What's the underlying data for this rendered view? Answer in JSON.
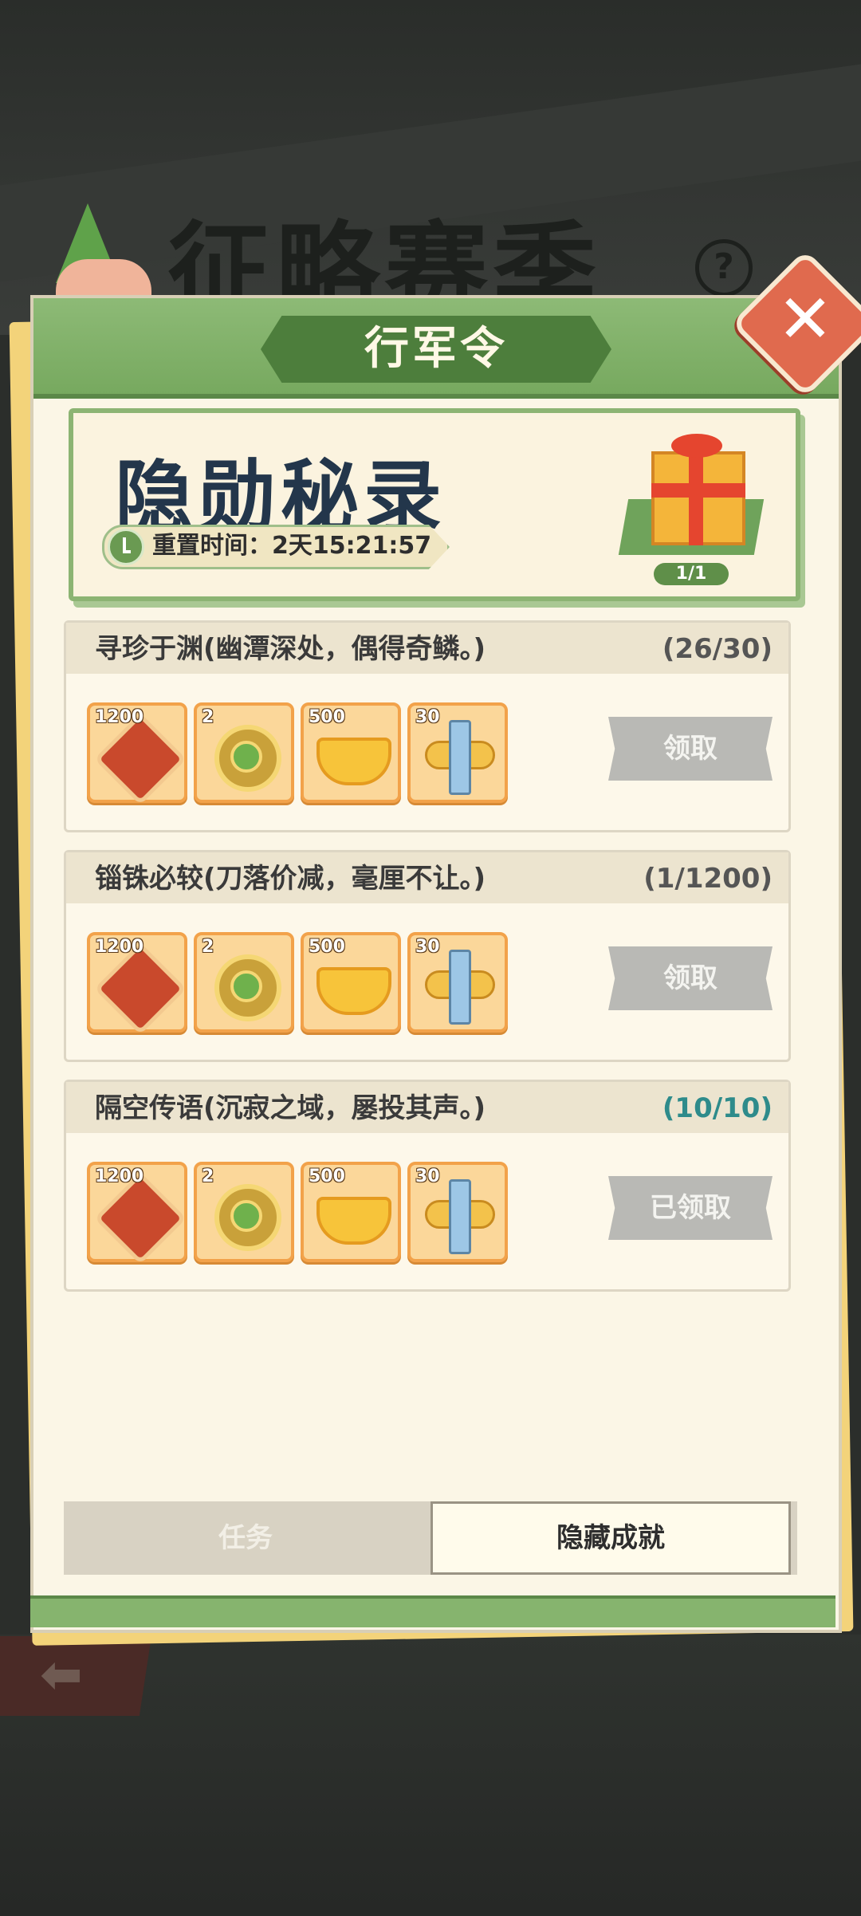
{
  "background": {
    "season_title": "征略赛季",
    "help_icon": "?"
  },
  "header": {
    "title": "行军令",
    "close_label": "✕"
  },
  "banner": {
    "title": "隐勋秘录",
    "timer_label": "重置时间：2天15:21:57",
    "gift_count": "1/1"
  },
  "tasks": [
    {
      "title": "寻珍于渊(幽潭深处，偶得奇鳞。)",
      "progress": "(26/30)",
      "rewards": [
        "1200",
        "2",
        "500",
        "30"
      ],
      "button": "领取"
    },
    {
      "title": "锱铢必较(刀落价减，毫厘不让。)",
      "progress": "(1/1200)",
      "rewards": [
        "1200",
        "2",
        "500",
        "30"
      ],
      "button": "领取"
    },
    {
      "title": "隔空传语(沉寂之域，屡投其声。)",
      "progress": "(10/10)",
      "rewards": [
        "1200",
        "2",
        "500",
        "30"
      ],
      "button": "已领取"
    }
  ],
  "tabs": {
    "task": "任务",
    "hidden": "隐藏成就"
  },
  "icons": {
    "reward_1": "token-icon",
    "reward_2": "coin-icon",
    "reward_3": "ingot-icon",
    "reward_4": "sword-wings-icon"
  }
}
